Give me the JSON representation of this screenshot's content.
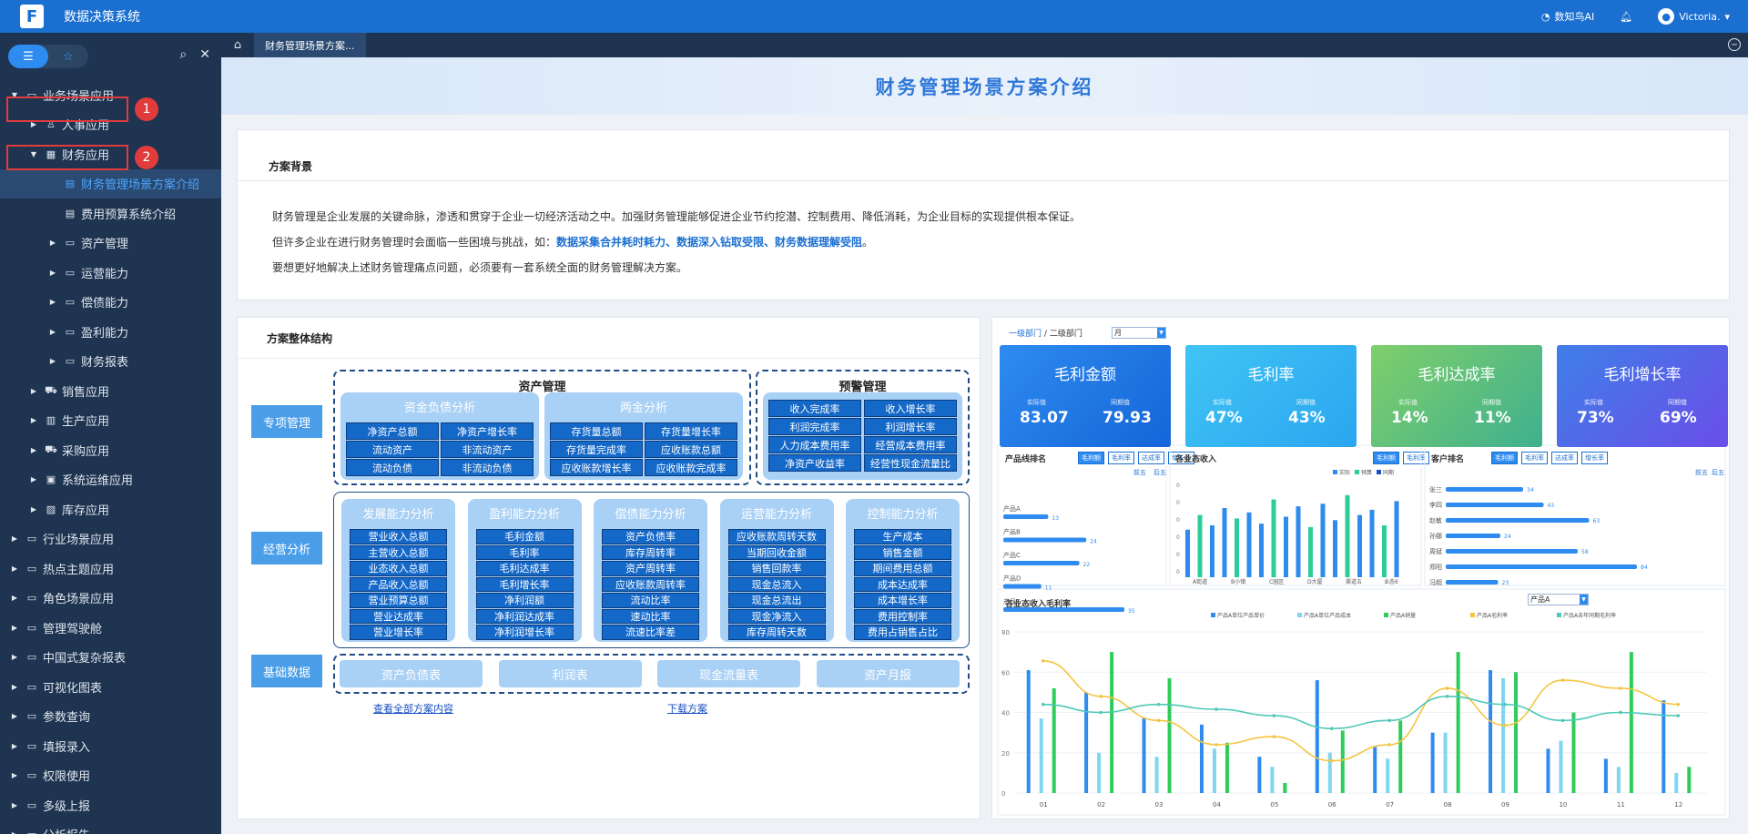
{
  "app": {
    "title": "数据决策系统",
    "logo": "F"
  },
  "topbar": {
    "ai": "数知鸟AI",
    "user": "Victoria.",
    "bell": "bell-icon"
  },
  "sidebar": {
    "items": [
      {
        "label": "业务场景应用",
        "lvl": 0,
        "open": true,
        "icon": "folder"
      },
      {
        "label": "人事应用",
        "lvl": 1,
        "open": false,
        "icon": "people"
      },
      {
        "label": "财务应用",
        "lvl": 1,
        "open": true,
        "icon": "table"
      },
      {
        "label": "财务管理场景方案介绍",
        "lvl": 2,
        "leaf": true,
        "active": true,
        "icon": "doc"
      },
      {
        "label": "费用预算系统介绍",
        "lvl": 2,
        "leaf": true,
        "icon": "doc"
      },
      {
        "label": "资产管理",
        "lvl": 2,
        "icon": "folder"
      },
      {
        "label": "运营能力",
        "lvl": 2,
        "icon": "folder"
      },
      {
        "label": "偿债能力",
        "lvl": 2,
        "icon": "folder"
      },
      {
        "label": "盈利能力",
        "lvl": 2,
        "icon": "folder"
      },
      {
        "label": "财务报表",
        "lvl": 2,
        "icon": "folder"
      },
      {
        "label": "销售应用",
        "lvl": 1,
        "icon": "cart"
      },
      {
        "label": "生产应用",
        "lvl": 1,
        "icon": "chart"
      },
      {
        "label": "采购应用",
        "lvl": 1,
        "icon": "cart"
      },
      {
        "label": "系统运维应用",
        "lvl": 1,
        "icon": "monitor"
      },
      {
        "label": "库存应用",
        "lvl": 1,
        "icon": "box"
      },
      {
        "label": "行业场景应用",
        "lvl": 0,
        "icon": "folder"
      },
      {
        "label": "热点主题应用",
        "lvl": 0,
        "icon": "folder"
      },
      {
        "label": "角色场景应用",
        "lvl": 0,
        "icon": "folder"
      },
      {
        "label": "管理驾驶舱",
        "lvl": 0,
        "icon": "folder"
      },
      {
        "label": "中国式复杂报表",
        "lvl": 0,
        "icon": "folder"
      },
      {
        "label": "可视化图表",
        "lvl": 0,
        "icon": "folder"
      },
      {
        "label": "参数查询",
        "lvl": 0,
        "icon": "folder"
      },
      {
        "label": "填报录入",
        "lvl": 0,
        "icon": "folder"
      },
      {
        "label": "权限使用",
        "lvl": 0,
        "icon": "folder"
      },
      {
        "label": "多级上报",
        "lvl": 0,
        "icon": "folder"
      },
      {
        "label": "分析报告",
        "lvl": 0,
        "icon": "folder"
      }
    ],
    "badges": [
      "1",
      "2"
    ]
  },
  "tabs": {
    "active": "财务管理场景方案..."
  },
  "page": {
    "title": "财务管理场景方案介绍"
  },
  "background": {
    "title": "方案背景",
    "line1": "财务管理是企业发展的关键命脉，渗透和贯穿于企业一切经济活动之中。加强财务管理能够促进企业节约挖潜、控制费用、降低消耗，为企业目标的实现提供根本保证。",
    "line2_pre": "但许多企业在进行财务管理时会面临一些困境与挑战，如：",
    "line2_bold": "数据采集合并耗时耗力、数据深入钻取受限、财务数据理解受阻",
    "line2_end": "。",
    "line3": "要想更好地解决上述财务管理痛点问题，必须要有一套系统全面的财务管理解决方案。"
  },
  "structure": {
    "title": "方案整体结构",
    "labels": {
      "special": "专项管理",
      "operation": "经营分析",
      "base": "基础数据"
    },
    "asset": {
      "title": "资产管理",
      "groups": [
        {
          "title": "资金负债分析",
          "cells": [
            "净资产总额",
            "净资产增长率",
            "流动资产",
            "非流动资产",
            "流动负债",
            "非流动负债"
          ]
        },
        {
          "title": "两金分析",
          "cells": [
            "存货量总额",
            "存货量增长率",
            "存货量完成率",
            "应收账款总额",
            "应收账款增长率",
            "应收账款完成率"
          ]
        }
      ]
    },
    "warning": {
      "title": "预警管理",
      "cells": [
        "收入完成率",
        "收入增长率",
        "利润完成率",
        "利润增长率",
        "人力成本费用率",
        "经营成本费用率",
        "净资产收益率",
        "经营性现金流量比"
      ]
    },
    "ops": [
      {
        "title": "发展能力分析",
        "cells": [
          "营业收入总额",
          "主营收入总额",
          "业态收入总额",
          "产品收入总额",
          "营业预算总额",
          "营业达成率",
          "营业增长率"
        ]
      },
      {
        "title": "盈利能力分析",
        "cells": [
          "毛利金额",
          "毛利率",
          "毛利达成率",
          "毛利增长率",
          "净利润额",
          "净利润达成率",
          "净利润增长率"
        ]
      },
      {
        "title": "偿债能力分析",
        "cells": [
          "资产负债率",
          "库存周转率",
          "资产周转率",
          "应收账款周转率",
          "流动比率",
          "速动比率",
          "流速比率差"
        ]
      },
      {
        "title": "运营能力分析",
        "cells": [
          "应收账款周转天数",
          "当期回收金额",
          "销售回款率",
          "现金总流入",
          "现金总流出",
          "现金净流入",
          "库存周转天数"
        ]
      },
      {
        "title": "控制能力分析",
        "cells": [
          "生产成本",
          "销售金额",
          "期间费用总额",
          "成本达成率",
          "成本增长率",
          "费用控制率",
          "费用占销售占比"
        ]
      }
    ],
    "base": [
      "资产负债表",
      "利润表",
      "现金流量表",
      "资产月报"
    ],
    "links": [
      "查看全部方案内容",
      "下载方案"
    ]
  },
  "dashboard": {
    "breadcrumb": [
      "一级部门",
      "二级部门"
    ],
    "sep": "/",
    "period": "月",
    "kpis": [
      {
        "title": "毛利金额",
        "l1": "实际值",
        "v1": "83.07",
        "l2": "同期值",
        "v2": "79.93",
        "c1": "#2e8bf0",
        "c2": "#1565d8"
      },
      {
        "title": "毛利率",
        "l1": "实际值",
        "v1": "47%",
        "l2": "同期值",
        "v2": "43%",
        "c1": "#40c4f4",
        "c2": "#2aa6f0"
      },
      {
        "title": "毛利达成率",
        "l1": "实际值",
        "v1": "14%",
        "l2": "同期值",
        "v2": "11%",
        "c1": "#7fcf6a",
        "c2": "#3fb08f"
      },
      {
        "title": "毛利增长率",
        "l1": "实际值",
        "v1": "73%",
        "l2": "同期值",
        "v2": "69%",
        "c1": "#3f7fe8",
        "c2": "#6a4ee8"
      }
    ],
    "panels": {
      "p1": "产品线排名",
      "p2": "各业态收入",
      "p3": "客户排名",
      "p4": "各业态收入毛利率"
    },
    "p1tabs": [
      "毛利额",
      "毛利率",
      "达成率",
      "增长率"
    ],
    "p1links": [
      "前五",
      "后五"
    ],
    "p2tabs": [
      "毛利额",
      "毛利率"
    ],
    "p3tabs": [
      "毛利额",
      "毛利率",
      "达成率",
      "增长率"
    ],
    "p3links": [
      "前五",
      "后五"
    ],
    "p4select": "产品A"
  },
  "chart_data": [
    {
      "type": "bar",
      "title": "产品线排名",
      "categories": [
        "产品A",
        "产品B",
        "产品C",
        "产品D",
        "产品E"
      ],
      "values": [
        13,
        24,
        22,
        11,
        35
      ]
    },
    {
      "type": "bar",
      "title": "各业态收入",
      "categories": [
        "A街道",
        "B小镇",
        "C园区",
        "D大厦",
        "渠道五",
        "业态6"
      ],
      "series": [
        {
          "name": "实际",
          "values": [
            0.55,
            0.72,
            0.6,
            0.8,
            0.68,
            0.75,
            0.62,
            0.9,
            0.7,
            0.82,
            0.58,
            0.85,
            0.66,
            0.95,
            0.72,
            0.78,
            0.6,
            0.88
          ]
        },
        {
          "name": "预算",
          "values": []
        },
        {
          "name": "同期",
          "values": []
        }
      ]
    },
    {
      "type": "bar",
      "title": "客户排名",
      "categories": [
        "张三",
        "李四",
        "赵敏",
        "孙娜",
        "周斌",
        "郑阳",
        "冯超"
      ],
      "values": [
        34,
        43,
        63,
        24,
        58,
        84,
        23
      ]
    },
    {
      "type": "bar",
      "title": "各业态收入毛利率",
      "categories": [
        "01",
        "02",
        "03",
        "04",
        "05",
        "06",
        "07",
        "08",
        "09",
        "10",
        "11",
        "12"
      ],
      "ylim": [
        0,
        80
      ],
      "series": [
        {
          "name": "产品A单位产品单价",
          "values": [
            61,
            50,
            37,
            34,
            18,
            56,
            23,
            30,
            61,
            22,
            17,
            46
          ]
        },
        {
          "name": "产品A单位产品成本",
          "values": [
            37,
            20,
            18,
            22,
            13,
            20,
            17,
            30,
            57,
            26,
            13,
            10
          ]
        },
        {
          "name": "产品A销量",
          "values": [
            52,
            70,
            57,
            25,
            5,
            31,
            36,
            70,
            60,
            40,
            70,
            13
          ]
        },
        {
          "name": "产品A毛利率",
          "values": [
            0.82,
            0.6,
            0.45,
            0.3,
            0.35,
            0.2,
            0.3,
            0.65,
            0.42,
            0.7,
            0.65,
            0.55
          ]
        },
        {
          "name": "产品A去年同期毛利率",
          "values": [
            0.55,
            0.5,
            0.55,
            0.52,
            0.48,
            0.4,
            0.45,
            0.6,
            0.55,
            0.45,
            0.5,
            0.48
          ]
        }
      ]
    }
  ]
}
